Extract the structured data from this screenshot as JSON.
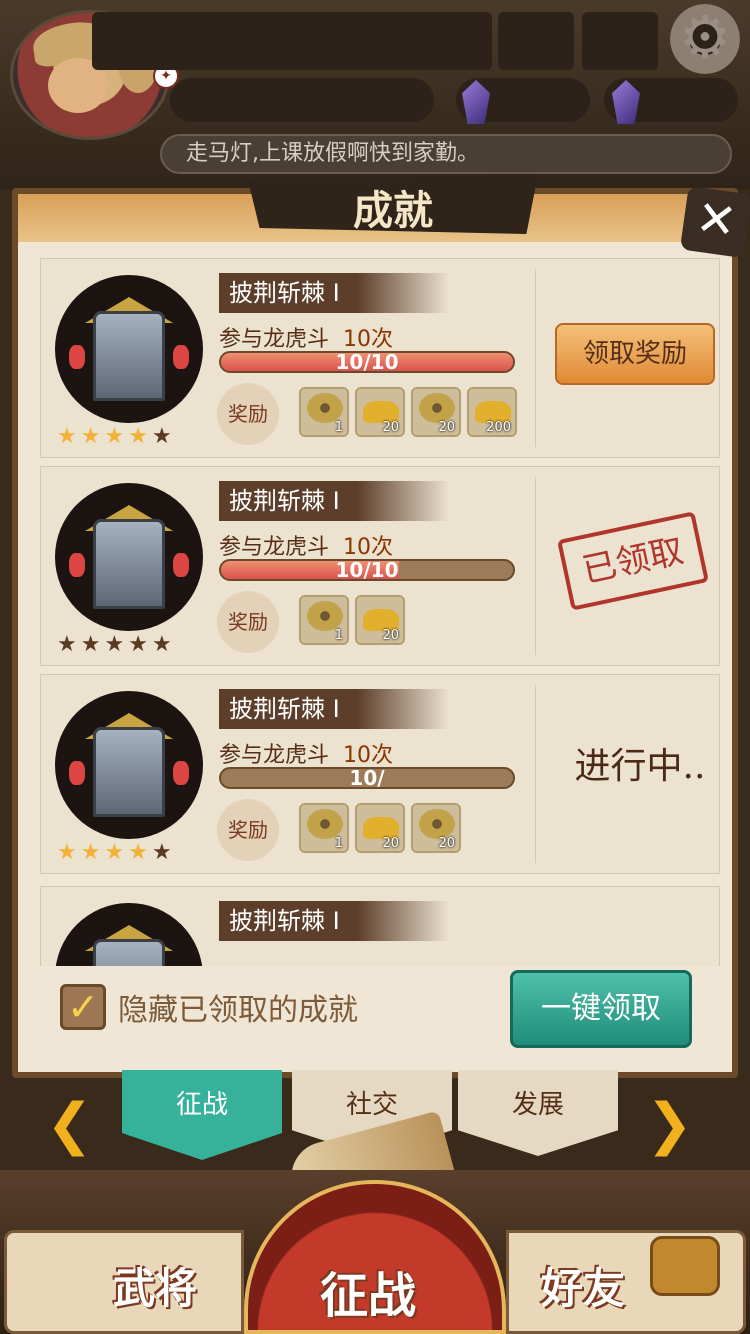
{
  "marquee": "走马灯,上课放假啊快到家勤。",
  "panel": {
    "title": "成就",
    "close_icon": "✕"
  },
  "achievements": [
    {
      "title": "披荆斩棘 Ⅰ",
      "task": "参与龙虎斗",
      "count": "10次",
      "progress_text": "10/10",
      "progress": 1.0,
      "reward_label": "奖励",
      "stars": [
        1,
        1,
        1,
        1,
        0
      ],
      "status": "claim",
      "items": [
        {
          "type": "coin",
          "qty": "1"
        },
        {
          "type": "ingot",
          "qty": "20"
        },
        {
          "type": "coin",
          "qty": "20"
        },
        {
          "type": "ingot",
          "qty": "200"
        }
      ]
    },
    {
      "title": "披荆斩棘 Ⅰ",
      "task": "参与龙虎斗",
      "count": "10次",
      "progress_text": "10/10",
      "progress": 0.61,
      "reward_label": "奖励",
      "stars": [
        0,
        0,
        0,
        0,
        0
      ],
      "status": "claimed",
      "items": [
        {
          "type": "coin",
          "qty": "1"
        },
        {
          "type": "ingot",
          "qty": "20"
        }
      ]
    },
    {
      "title": "披荆斩棘 Ⅰ",
      "task": "参与龙虎斗",
      "count": "10次",
      "progress_text": "10/",
      "progress": 0.0,
      "reward_label": "奖励",
      "stars": [
        1,
        1,
        1,
        1,
        0
      ],
      "status": "in_progress",
      "items": [
        {
          "type": "coin",
          "qty": "1"
        },
        {
          "type": "ingot",
          "qty": "20"
        },
        {
          "type": "coin",
          "qty": "20"
        }
      ]
    },
    {
      "title": "披荆斩棘 Ⅰ"
    }
  ],
  "labels": {
    "claim_button": "领取奖励",
    "claimed_stamp": "已领取",
    "in_progress": "进行中..",
    "hide_claimed": "隐藏已领取的成就",
    "claim_all": "一键领取"
  },
  "tabs": [
    {
      "label": "征战",
      "active": true
    },
    {
      "label": "社交",
      "active": false
    },
    {
      "label": "发展",
      "active": false
    }
  ],
  "bottom_nav": {
    "left": "武将",
    "center": "征战",
    "right": "好友"
  },
  "colors": {
    "task_text": "#572F17",
    "count_text": "#8A3601",
    "hide_text": "#7C5B3A",
    "accent_green": "#36B29A"
  }
}
